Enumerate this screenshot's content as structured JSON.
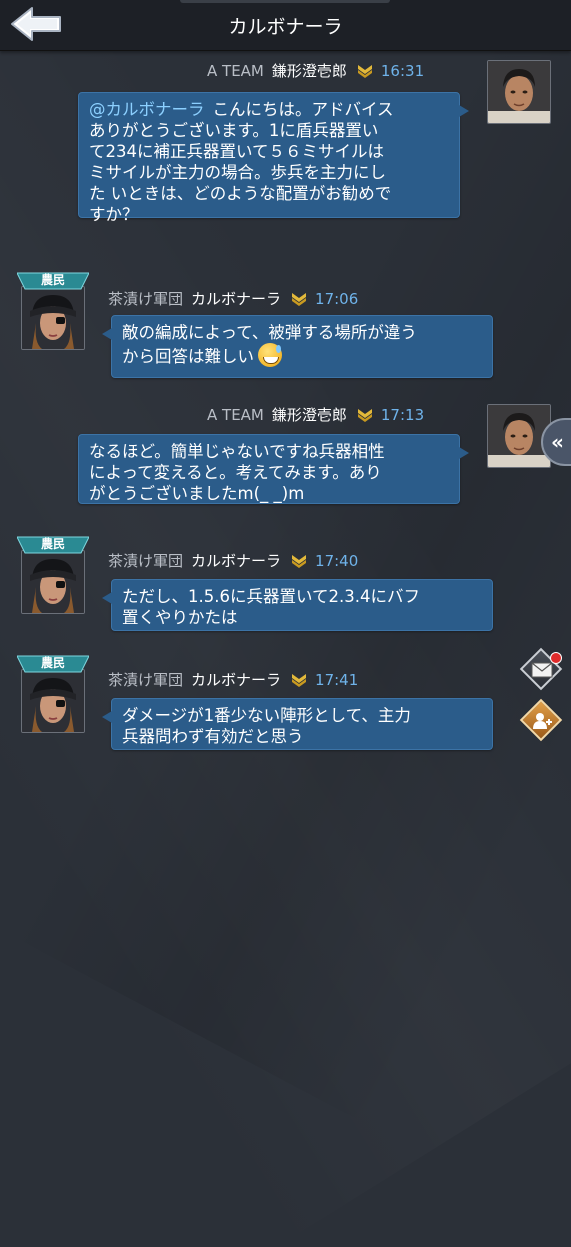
{
  "header": {
    "title": "カルボナーラ"
  },
  "messages": [
    {
      "side": "right",
      "team": "A TEAM",
      "name": "鎌形澄壱郎",
      "time": "16:31",
      "mention": "@カルボナーラ",
      "lines": [
        "こんにちは。アドバイス",
        "ありがとうございます。1に盾兵器置い",
        "て234に補正兵器置いて５６ミサイルは",
        "ミサイルが主力の場合。歩兵を主力にし",
        "た いときは、どのような配置がお勧めで",
        "すか？"
      ]
    },
    {
      "side": "left",
      "badge": "農民",
      "team": "茶漬け軍団",
      "name": "カルボナーラ",
      "time": "17:06",
      "lines": [
        "敵の編成によって、被弾する場所が違う",
        "から回答は難しい"
      ],
      "emoji": "grinning-sweat-emoji"
    },
    {
      "side": "right",
      "team": "A TEAM",
      "name": "鎌形澄壱郎",
      "time": "17:13",
      "lines": [
        "なるほど。簡単じゃないですね兵器相性",
        "によって変えると。考えてみます。あり",
        "がとうございましたm(_ _)m"
      ]
    },
    {
      "side": "left",
      "badge": "農民",
      "team": "茶漬け軍団",
      "name": "カルボナーラ",
      "time": "17:40",
      "lines": [
        "ただし、1.5.6に兵器置いて2.3.4にバフ",
        "置くやりかたは"
      ]
    },
    {
      "side": "left",
      "badge": "農民",
      "team": "茶漬け軍団",
      "name": "カルボナーラ",
      "time": "17:41",
      "lines": [
        "ダメージが1番少ない陣形として、主力",
        "兵器問わず有効だと思う"
      ]
    }
  ],
  "side_panel": {
    "collapse_label": "«"
  },
  "icons": {
    "back": "back-arrow-icon",
    "rank": "chevron-rank-icon",
    "mail": "mail-icon",
    "friend": "add-friend-icon"
  },
  "colors": {
    "bubble": "#2b5c8a",
    "time": "#6fb3ea",
    "header": "#1d2026",
    "badge": "#2a8a93"
  }
}
